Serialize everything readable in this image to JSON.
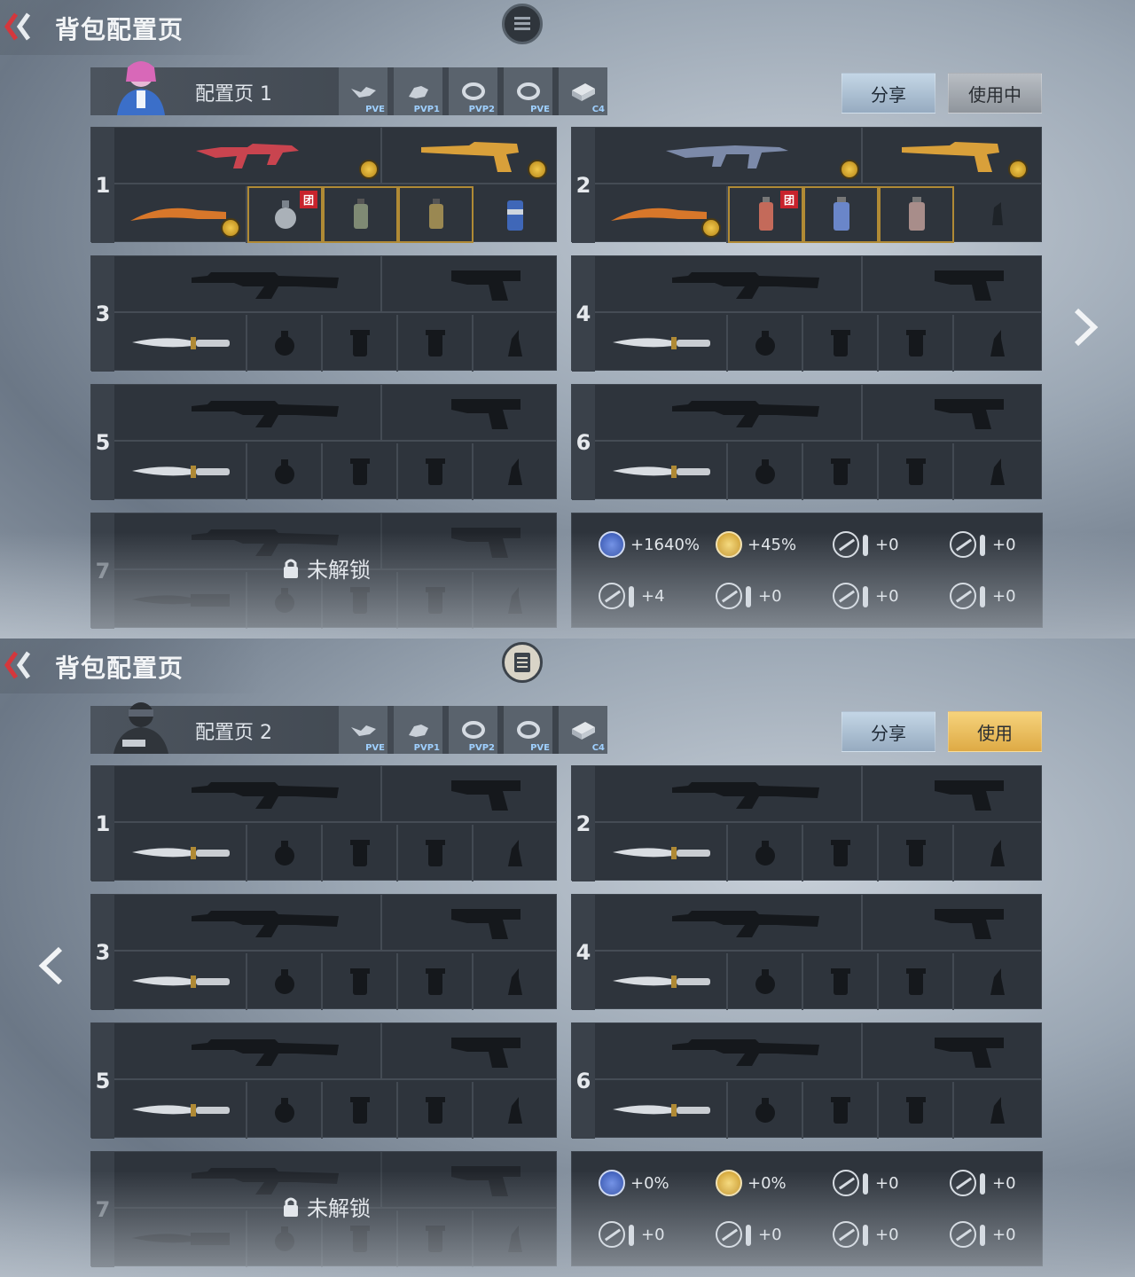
{
  "screens": [
    {
      "title": "背包配置页",
      "config_name": "配置页 1",
      "modes": [
        {
          "tag": "PVE",
          "icon": "drone-icon"
        },
        {
          "tag": "PVP1",
          "icon": "pet-icon"
        },
        {
          "tag": "PVP2",
          "icon": "ring-icon"
        },
        {
          "tag": "PVE",
          "icon": "ring-icon"
        },
        {
          "tag": "C4",
          "icon": "c4-icon"
        }
      ],
      "share_label": "分享",
      "use_label": "使用中",
      "slots": [
        {
          "num": "1",
          "team_badge": "团"
        },
        {
          "num": "2",
          "team_badge": "团"
        },
        {
          "num": "3"
        },
        {
          "num": "4"
        },
        {
          "num": "5"
        },
        {
          "num": "6"
        },
        {
          "num": "7",
          "locked_label": "未解锁"
        }
      ],
      "stats": [
        "+1640%",
        "+45%",
        "+0",
        "+0",
        "+4",
        "+0",
        "+0",
        "+0"
      ]
    },
    {
      "title": "背包配置页",
      "config_name": "配置页 2",
      "modes": [
        {
          "tag": "PVE",
          "icon": "drone-icon"
        },
        {
          "tag": "PVP1",
          "icon": "pet-icon"
        },
        {
          "tag": "PVP2",
          "icon": "ring-icon"
        },
        {
          "tag": "PVE",
          "icon": "ring-icon"
        },
        {
          "tag": "C4",
          "icon": "c4-icon"
        }
      ],
      "share_label": "分享",
      "use_label": "使用",
      "slots": [
        {
          "num": "1"
        },
        {
          "num": "2"
        },
        {
          "num": "3"
        },
        {
          "num": "4"
        },
        {
          "num": "5"
        },
        {
          "num": "6"
        },
        {
          "num": "7",
          "locked_label": "未解锁"
        }
      ],
      "stats": [
        "+0%",
        "+0%",
        "+0",
        "+0",
        "+0",
        "+0",
        "+0",
        "+0"
      ]
    }
  ],
  "colors": {
    "accent_red": "#d4373c",
    "use_active": "#deaa45",
    "coin": "#f1c84c"
  }
}
